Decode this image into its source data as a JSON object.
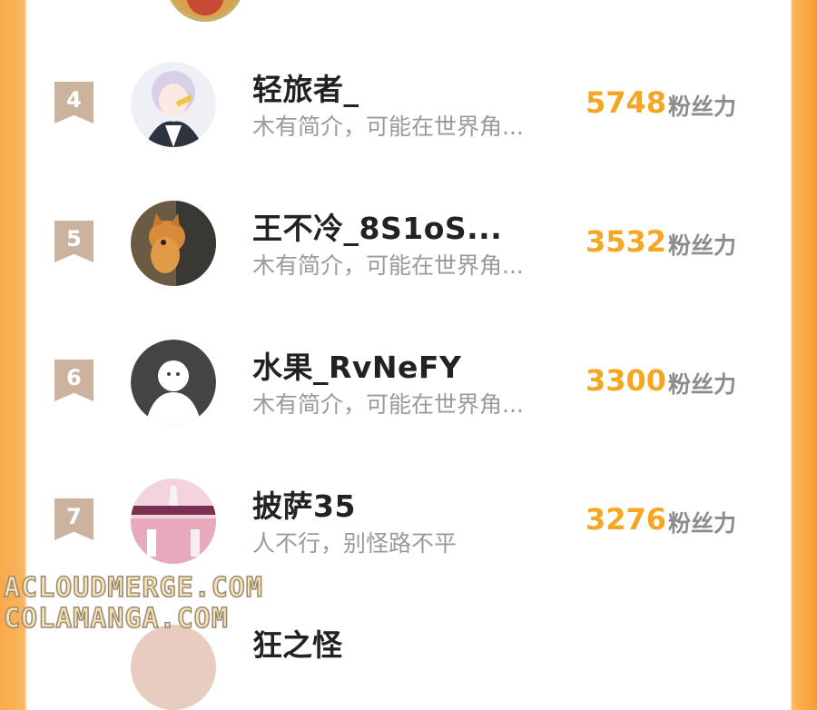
{
  "users": [
    {
      "rank": "4",
      "name": "轻旅者_",
      "bio": "木有简介，可能在世界角...",
      "score": "5748",
      "unit": "粉丝力"
    },
    {
      "rank": "5",
      "name": "王不冷_8S1oS...",
      "bio": "木有简介，可能在世界角...",
      "score": "3532",
      "unit": "粉丝力"
    },
    {
      "rank": "6",
      "name": "水果_RvNeFY",
      "bio": "木有简介，可能在世界角...",
      "score": "3300",
      "unit": "粉丝力"
    },
    {
      "rank": "7",
      "name": "披萨35",
      "bio": "人不行，别怪路不平",
      "score": "3276",
      "unit": "粉丝力"
    }
  ],
  "partial_next_name": "狂之怪",
  "watermark": {
    "line1": "ACLOUDMERGE.COM",
    "line2": "COLAMANGA.COM"
  },
  "colors": {
    "score": "#f5a623",
    "rank_badge": "#ccb3a0",
    "frame": "#f9a94a"
  }
}
